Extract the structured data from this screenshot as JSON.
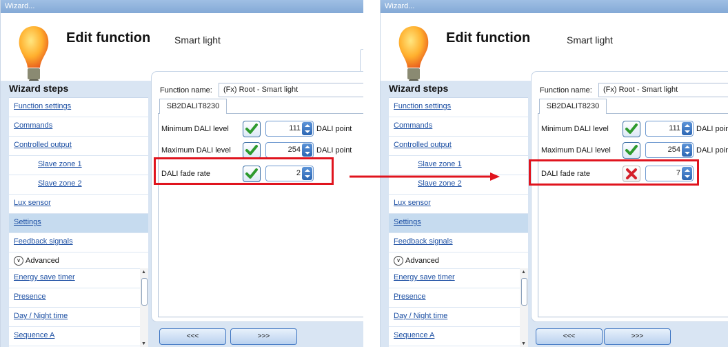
{
  "windows": [
    {
      "title": "Wizard...",
      "header": {
        "title": "Edit function",
        "subtitle": "Smart light"
      },
      "steps_title": "Wizard steps",
      "steps": [
        {
          "label": "Function settings"
        },
        {
          "label": "Commands"
        },
        {
          "label": "Controlled output"
        },
        {
          "label": "Slave zone 1"
        },
        {
          "label": "Slave zone 2"
        },
        {
          "label": "Lux sensor"
        },
        {
          "label": "Settings",
          "selected": true
        },
        {
          "label": "Feedback signals"
        }
      ],
      "advanced_label": "Advanced",
      "advanced_steps": [
        {
          "label": "Energy save timer"
        },
        {
          "label": "Presence"
        },
        {
          "label": "Day / Night time"
        },
        {
          "label": "Sequence A"
        }
      ],
      "function_name_label": "Function name:",
      "function_name_value": "(Fx) Root - Smart light",
      "tab_label": "SB2DALIT8230",
      "rows": [
        {
          "label": "Minimum DALI level",
          "checked": true,
          "value": "111",
          "unit": "DALI point"
        },
        {
          "label": "Maximum DALI level",
          "checked": true,
          "value": "254",
          "unit": "DALI point"
        },
        {
          "label": "DALI fade rate",
          "checked": true,
          "value": "2",
          "unit": ""
        }
      ],
      "nav": {
        "back": "<<<",
        "next": ">>>"
      }
    },
    {
      "title": "Wizard...",
      "header": {
        "title": "Edit function",
        "subtitle": "Smart light"
      },
      "steps_title": "Wizard steps",
      "steps": [
        {
          "label": "Function settings"
        },
        {
          "label": "Commands"
        },
        {
          "label": "Controlled output"
        },
        {
          "label": "Slave zone 1"
        },
        {
          "label": "Slave zone 2"
        },
        {
          "label": "Lux sensor"
        },
        {
          "label": "Settings",
          "selected": true
        },
        {
          "label": "Feedback signals"
        }
      ],
      "advanced_label": "Advanced",
      "advanced_steps": [
        {
          "label": "Energy save timer"
        },
        {
          "label": "Presence"
        },
        {
          "label": "Day / Night time"
        },
        {
          "label": "Sequence A"
        }
      ],
      "function_name_label": "Function name:",
      "function_name_value": "(Fx) Root - Smart light",
      "tab_label": "SB2DALIT8230",
      "rows": [
        {
          "label": "Minimum DALI level",
          "checked": true,
          "value": "111",
          "unit": "DALI point"
        },
        {
          "label": "Maximum DALI level",
          "checked": true,
          "value": "254",
          "unit": "DALI point"
        },
        {
          "label": "DALI fade rate",
          "checked": false,
          "value": "7",
          "unit": ""
        }
      ],
      "nav": {
        "back": "<<<",
        "next": ">>>"
      }
    }
  ],
  "colors": {
    "highlight": "#e0141e",
    "link": "#1c4fa3",
    "selected_step": "#c6dbef",
    "panel_bg": "#d9e5f3"
  }
}
